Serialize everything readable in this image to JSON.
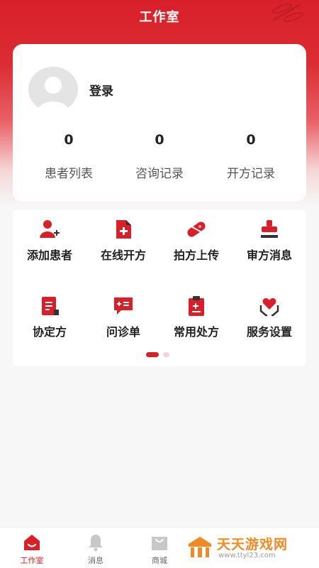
{
  "header": {
    "title": "工作室"
  },
  "profile": {
    "login_label": "登录",
    "stats": [
      {
        "value": "0",
        "label": "患者列表"
      },
      {
        "value": "0",
        "label": "咨询记录"
      },
      {
        "value": "0",
        "label": "开方记录"
      }
    ]
  },
  "menu": {
    "items": [
      {
        "label": "添加患者",
        "icon": "add-patient-icon"
      },
      {
        "label": "在线开方",
        "icon": "online-prescription-icon"
      },
      {
        "label": "拍方上传",
        "icon": "pill-upload-icon"
      },
      {
        "label": "审方消息",
        "icon": "stamp-review-icon"
      },
      {
        "label": "协定方",
        "icon": "agreement-doc-icon"
      },
      {
        "label": "问诊单",
        "icon": "consultation-form-icon"
      },
      {
        "label": "常用处方",
        "icon": "clipboard-icon"
      },
      {
        "label": "服务设置",
        "icon": "heart-hands-icon"
      }
    ],
    "page_count": 2,
    "active_page": 1
  },
  "tabbar": {
    "items": [
      {
        "label": "工作室",
        "icon": "home-icon",
        "active": true
      },
      {
        "label": "消息",
        "icon": "bell-icon",
        "active": false
      },
      {
        "label": "商城",
        "icon": "shopping-bag-icon",
        "active": false
      }
    ]
  },
  "watermark": {
    "name": "天天游戏网",
    "url": "www.ttyl23.com"
  },
  "colors": {
    "brand_red": "#d8202a",
    "background": "#f7f7f7",
    "card": "#ffffff",
    "watermark_orange": "#f08a24"
  }
}
